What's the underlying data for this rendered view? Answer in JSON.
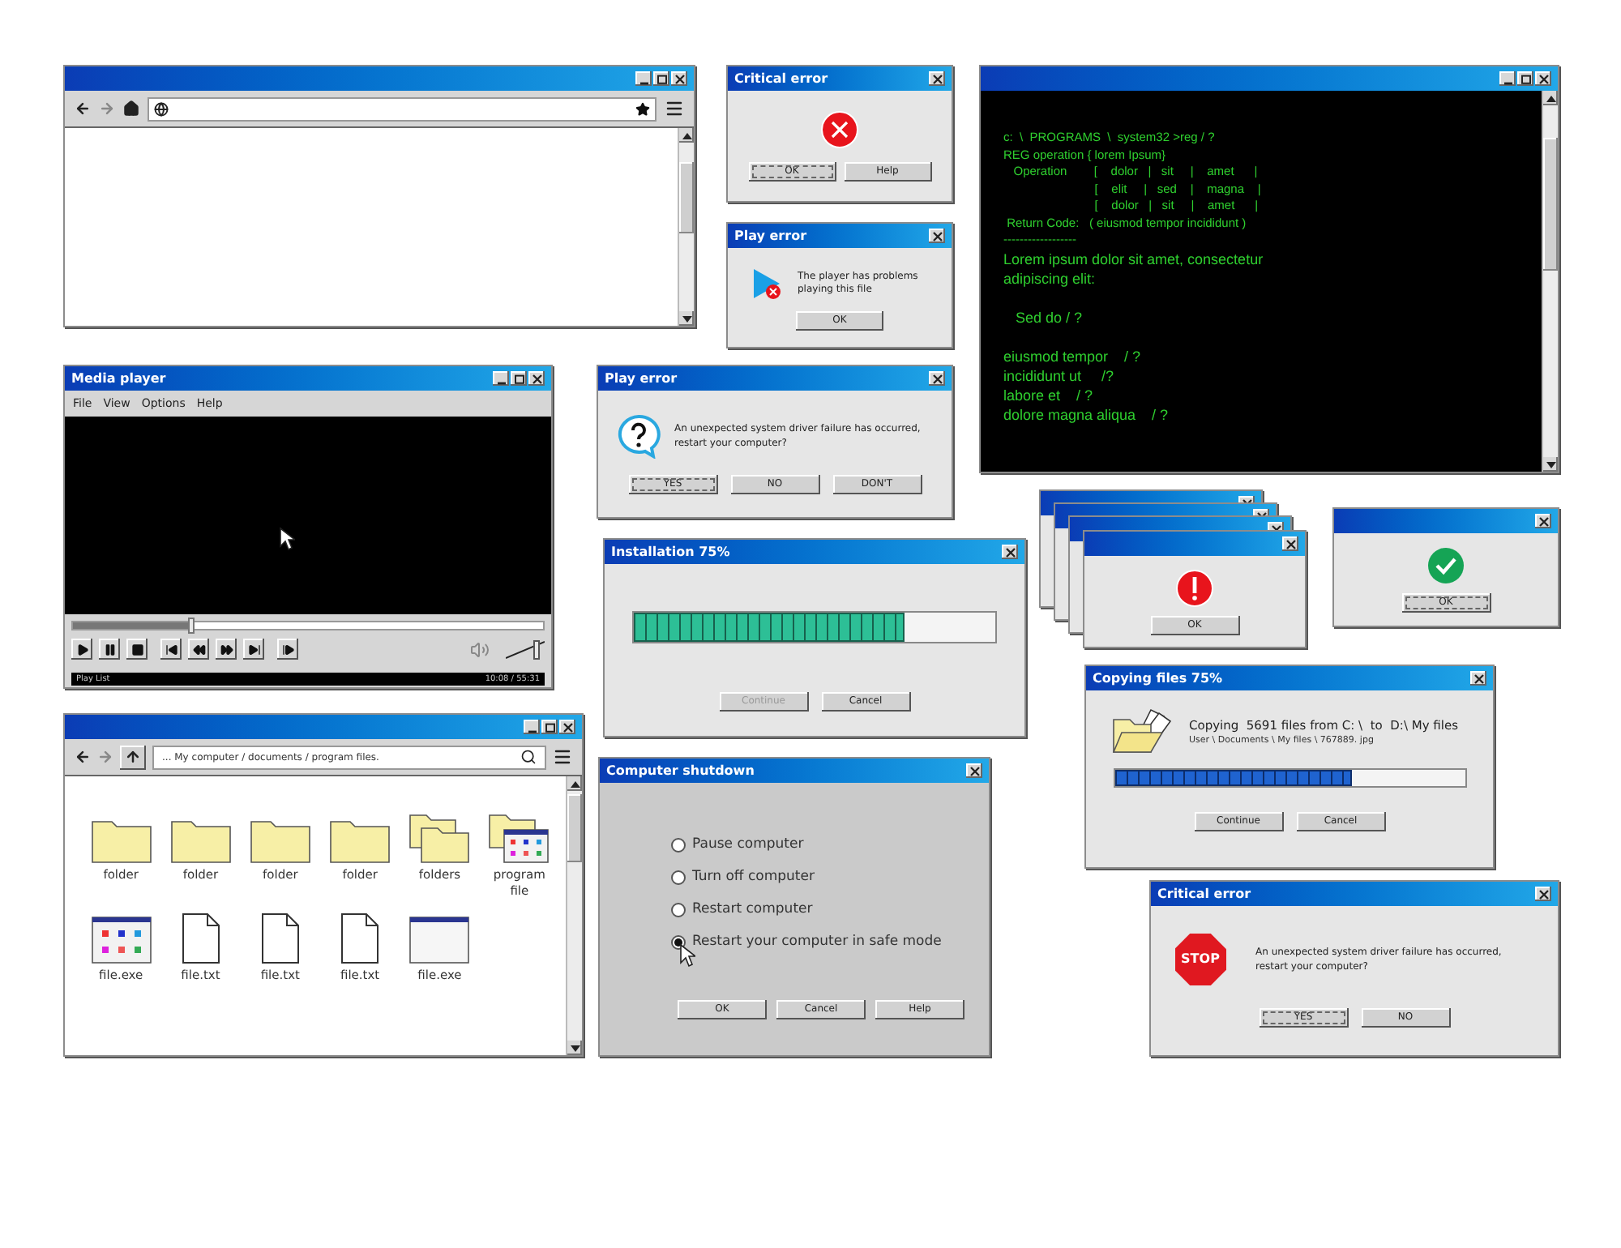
{
  "critical_error": {
    "title": "Critical error",
    "buttons": [
      {
        "label": "OK",
        "focused": true
      },
      {
        "label": "Help",
        "focused": false
      }
    ]
  },
  "play_error": {
    "title": "Play error",
    "message": "The player has problems playing this file",
    "buttons": [
      {
        "label": "OK",
        "focused": false
      }
    ]
  },
  "terminal": {
    "command_lines": [
      "c:  \\  PROGRAMS  \\  system32 >reg / ?",
      "REG operation { lorem Ipsum}",
      "   Operation        [    dolor   |   sit     |    amet      |",
      "                           [    elit     |   sed    |    magna    |",
      "                           [    dolor   |   sit     |    amet      |",
      " Return Code:   ( eiusmod tempor incididunt )",
      "------------------"
    ],
    "paragraphs": [
      [
        "Lorem ipsum dolor sit amet, consectetur",
        "adipiscing elit:"
      ],
      [
        "   Sed do / ?"
      ],
      [
        "eiusmod tempor    / ?",
        "incididunt ut     /?",
        "labore et    / ?",
        "dolore magna aliqua    / ?"
      ]
    ]
  },
  "media_player": {
    "title": "Media player",
    "menu": [
      "File",
      "View",
      "Options",
      "Help"
    ],
    "seek": {
      "level": 0.25
    },
    "volume": {
      "level": 0.8
    },
    "status": "Play List",
    "time": "10:08 / 55:31"
  },
  "play_error_question": {
    "title": "Play error",
    "message": "An unexpected system driver failure has occurred, restart your computer?",
    "buttons": [
      {
        "label": "YES",
        "focused": true
      },
      {
        "label": "NO",
        "focused": false
      },
      {
        "label": "DON'T",
        "focused": false
      }
    ]
  },
  "installation": {
    "title": "Installation 75%",
    "progress": {
      "level": 0.75
    },
    "buttons": [
      {
        "label": "Continue",
        "disabled": true
      },
      {
        "label": "Cancel",
        "disabled": false
      }
    ]
  },
  "warning_stack": {
    "buttons": [
      {
        "label": "OK",
        "focused": false
      }
    ]
  },
  "success": {
    "buttons": [
      {
        "label": "OK",
        "focused": true
      }
    ]
  },
  "copying": {
    "title": "Copying files 75%",
    "message": "Copying  5691 files from C: \\  to  D:\\ My files",
    "path": "User \\ Documents \\ My files \\ 767889. jpg",
    "progress": {
      "level": 0.68
    },
    "buttons": [
      {
        "label": "Continue",
        "focused": false
      },
      {
        "label": "Cancel",
        "focused": false
      }
    ]
  },
  "file_explorer": {
    "address": "... My computer / documents / program files.",
    "files": [
      {
        "name": "folder",
        "kind": "folder"
      },
      {
        "name": "folder",
        "kind": "folder"
      },
      {
        "name": "folder",
        "kind": "folder"
      },
      {
        "name": "folder",
        "kind": "folder"
      },
      {
        "name": "folders",
        "kind": "folders"
      },
      {
        "name": "program file",
        "kind": "program"
      },
      {
        "name": "file.exe",
        "kind": "exe"
      },
      {
        "name": "file.txt",
        "kind": "txt"
      },
      {
        "name": "file.txt",
        "kind": "txt"
      },
      {
        "name": "file.txt",
        "kind": "txt"
      },
      {
        "name": "file.exe",
        "kind": "window"
      }
    ]
  },
  "shutdown": {
    "title": "Computer shutdown",
    "options": [
      {
        "label": "Pause computer",
        "selected": false
      },
      {
        "label": "Turn off computer",
        "selected": false
      },
      {
        "label": "Restart computer",
        "selected": false
      },
      {
        "label": "Restart your computer in safe mode",
        "selected": true
      }
    ],
    "buttons": [
      {
        "label": "OK",
        "focused": false
      },
      {
        "label": "Cancel",
        "focused": false
      },
      {
        "label": "Help",
        "focused": false
      }
    ]
  },
  "stop_error": {
    "title": "Critical error",
    "sign": "STOP",
    "message": "An unexpected system driver failure has occurred, restart your computer?",
    "buttons": [
      {
        "label": "YES",
        "focused": true
      },
      {
        "label": "NO",
        "focused": false
      }
    ]
  }
}
